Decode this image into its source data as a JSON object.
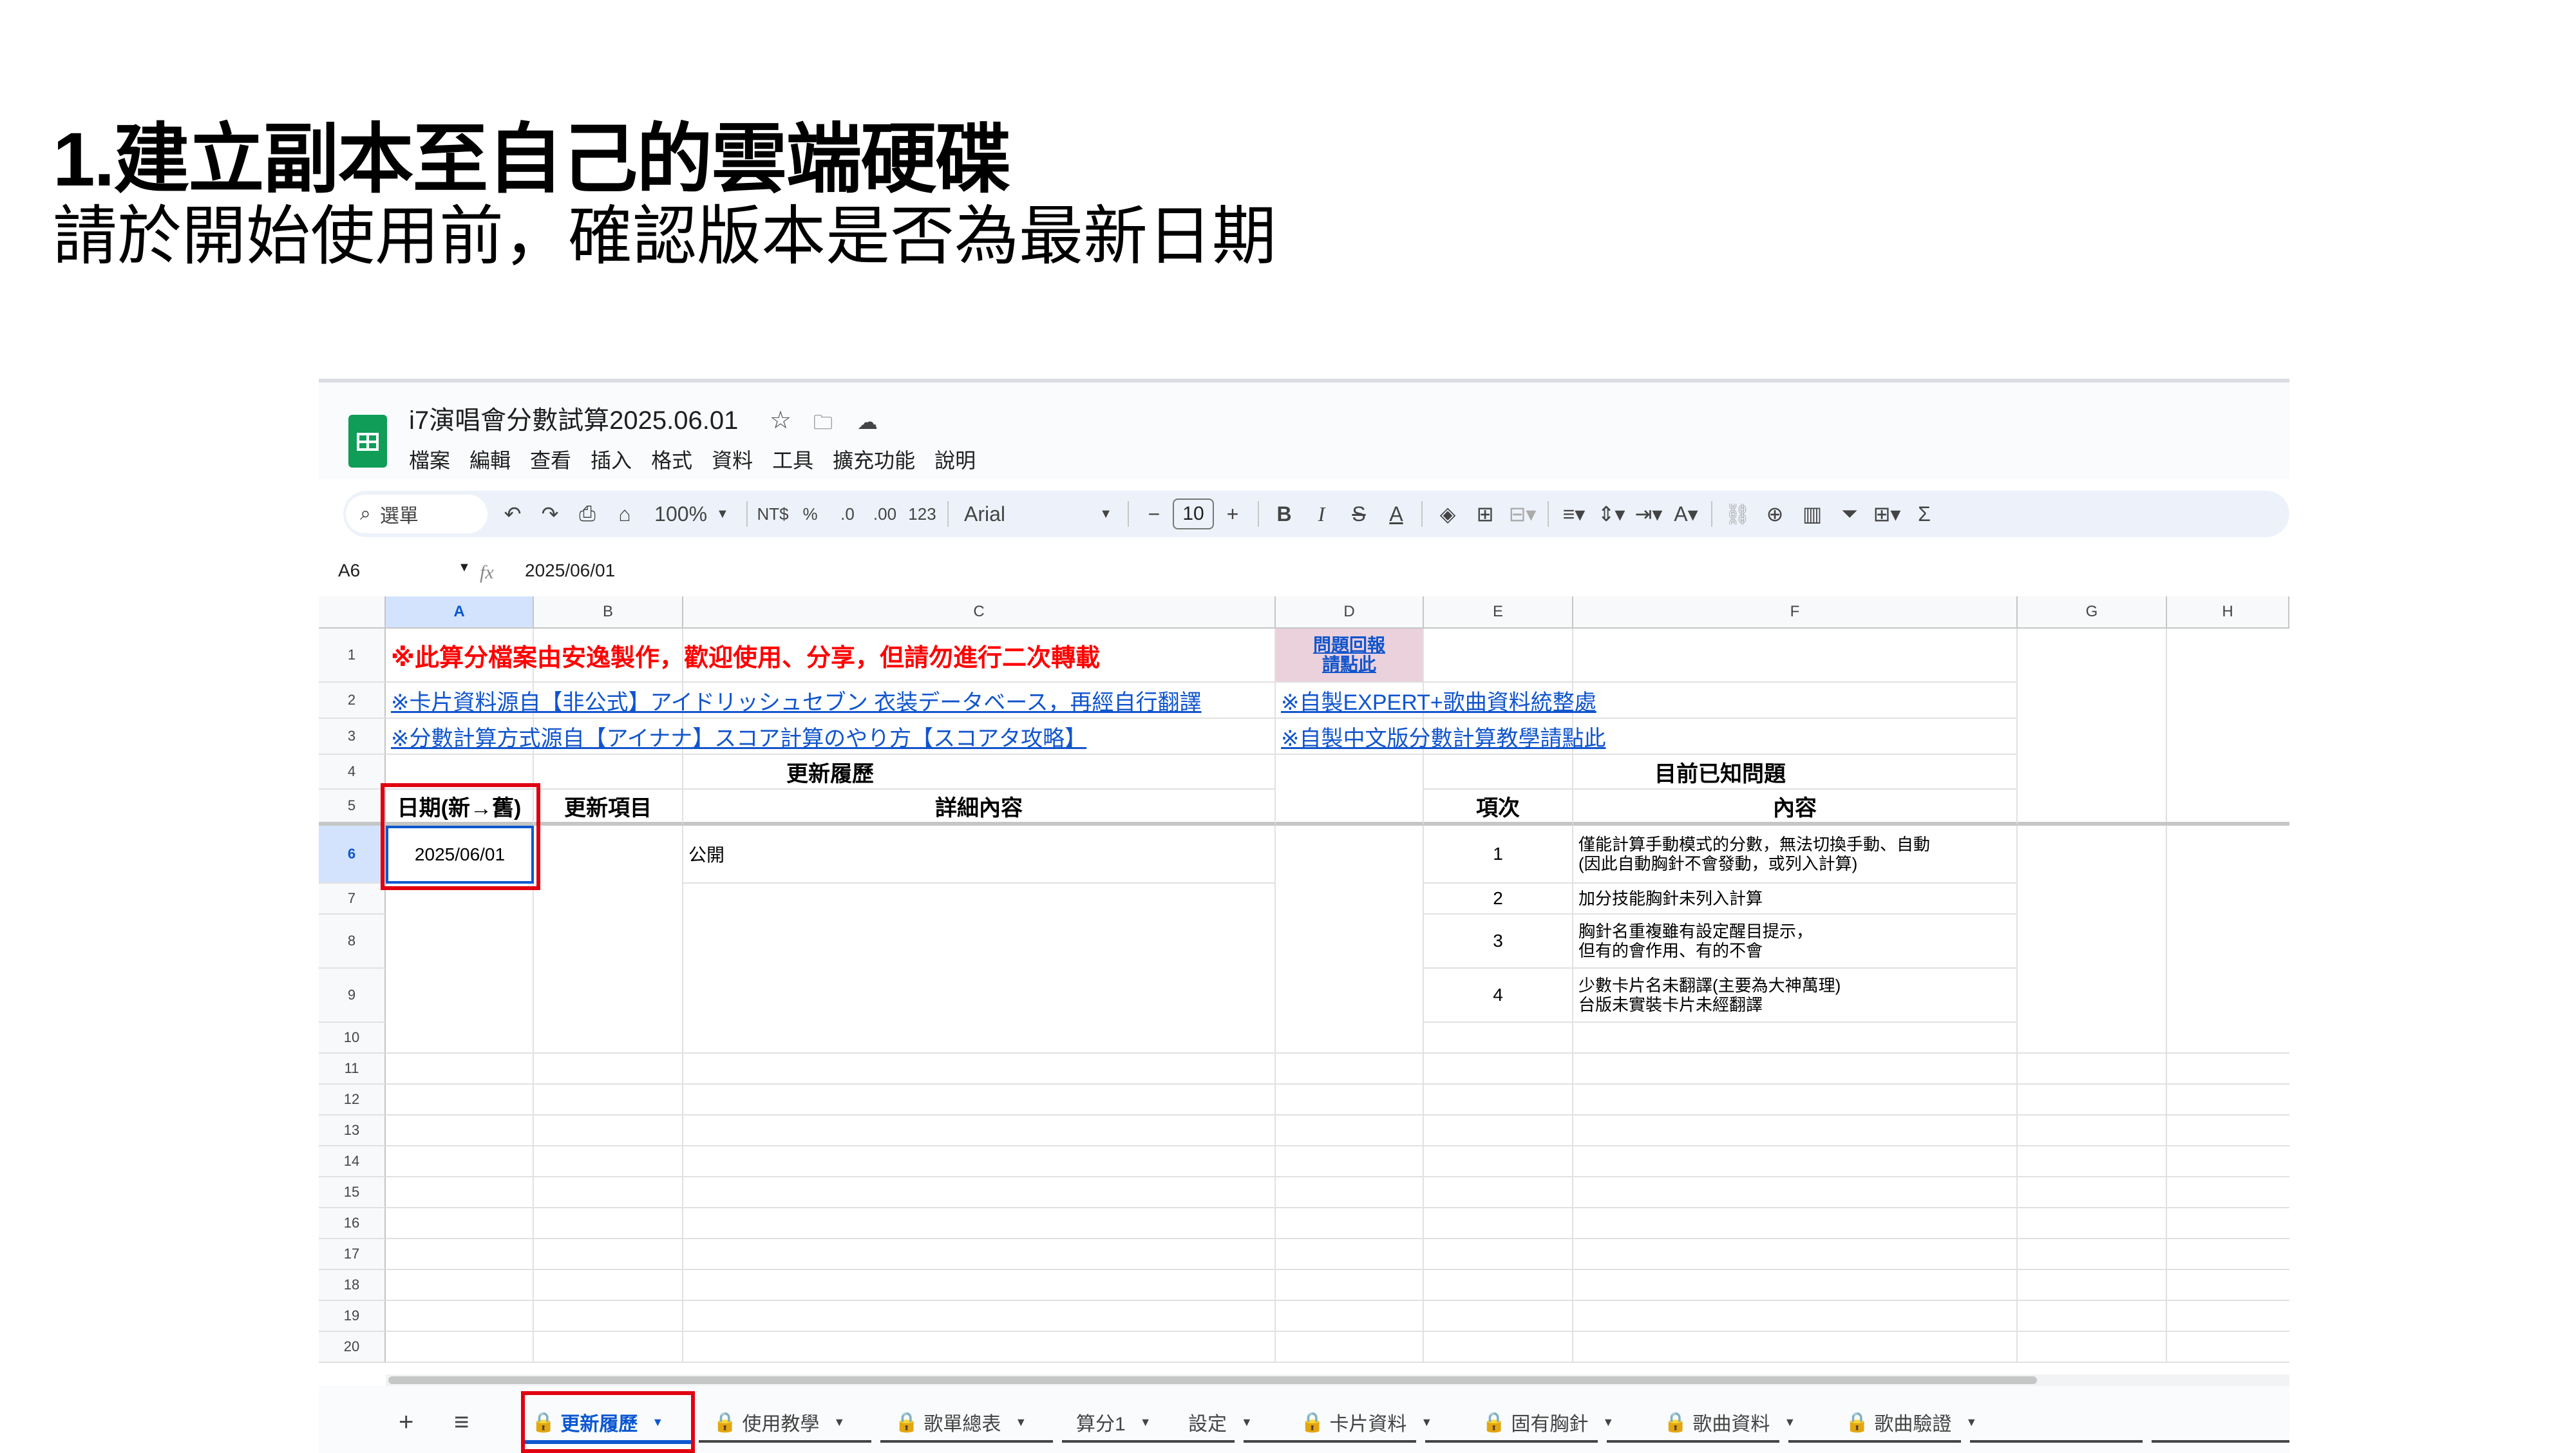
{
  "slide": {
    "title": "1.建立副本至自己的雲端硬碟",
    "subtitle": "請於開始使用前，確認版本是否為最新日期"
  },
  "app": {
    "doc_title": "i7演唱會分數試算2025.06.01",
    "menu": [
      "檔案",
      "編輯",
      "查看",
      "插入",
      "格式",
      "資料",
      "工具",
      "擴充功能",
      "說明"
    ],
    "search_label": "選單",
    "zoom": "100%",
    "currency": "NT$",
    "percent": "%",
    "dec_less": ".0",
    "dec_more": ".00",
    "number_format": "123",
    "font": "Arial",
    "font_size": "10",
    "name_box": "A6",
    "formula": "2025/06/01",
    "fx": "fx"
  },
  "sheet": {
    "columns": [
      "A",
      "B",
      "C",
      "D",
      "E",
      "F",
      "G",
      "H"
    ],
    "rows": [
      "1",
      "2",
      "3",
      "4",
      "5",
      "6",
      "7",
      "8",
      "9",
      "10",
      "11",
      "12",
      "13",
      "14",
      "15",
      "16",
      "17",
      "18",
      "19",
      "20"
    ],
    "r1_notice": "※此算分檔案由安逸製作，歡迎使用、分享，但請勿進行二次轉載",
    "r1_feedback": "問題回報\n請點此",
    "r2_source": "※卡片資料源自【非公式】アイドリッシュセブン 衣装データベース，再經自行翻譯",
    "r2_link": "※自製EXPERT+歌曲資料統整處",
    "r3_source": "※分數計算方式源自【アイナナ】スコア計算のやり方【スコアタ攻略】",
    "r3_link": "※自製中文版分數計算教學請點此",
    "update_history": "更新履歷",
    "known_issues": "目前已知問題",
    "h_date": "日期(新→舊)",
    "h_item": "更新項目",
    "h_detail": "詳細內容",
    "h_no": "項次",
    "h_content": "內容",
    "a6": "2025/06/01",
    "c6": "公開",
    "issues": [
      {
        "no": "1",
        "text": "僅能計算手動模式的分數，無法切換手動、自動\n(因此自動胸針不會發動，或列入計算)"
      },
      {
        "no": "2",
        "text": "加分技能胸針未列入計算"
      },
      {
        "no": "3",
        "text": "胸針名重複雖有設定醒目提示，\n但有的會作用、有的不會"
      },
      {
        "no": "4",
        "text": "少數卡片名未翻譯(主要為大神萬理)\n台版未實裝卡片未經翻譯"
      }
    ]
  },
  "tabs": [
    {
      "label": "更新履歷",
      "locked": true,
      "active": true
    },
    {
      "label": "使用教學",
      "locked": true,
      "active": false
    },
    {
      "label": "歌單總表",
      "locked": true,
      "active": false
    },
    {
      "label": "算分1",
      "locked": false,
      "active": false
    },
    {
      "label": "設定",
      "locked": false,
      "active": false
    },
    {
      "label": "卡片資料",
      "locked": true,
      "active": false
    },
    {
      "label": "固有胸針",
      "locked": true,
      "active": false
    },
    {
      "label": "歌曲資料",
      "locked": true,
      "active": false
    },
    {
      "label": "歌曲驗證",
      "locked": true,
      "active": false
    }
  ],
  "colors": {
    "accent": "#0b57d0",
    "highlight_box": "#e0000f",
    "sheets_green": "#0f9d58",
    "link": "#1155cc"
  }
}
